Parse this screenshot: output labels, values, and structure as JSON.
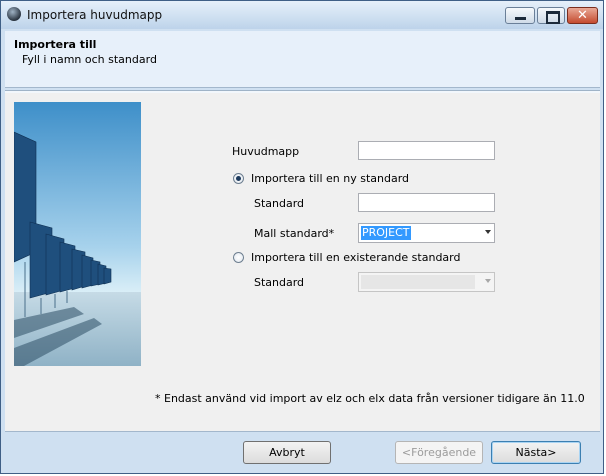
{
  "window": {
    "title": "Importera huvudmapp"
  },
  "header": {
    "title": "Importera till",
    "subtitle": "Fyll i namn och standard"
  },
  "form": {
    "huvudmapp_label": "Huvudmapp",
    "huvudmapp_value": "",
    "radio_new_label": "Importera till en ny standard",
    "radio_new_selected": true,
    "standard_new_label": "Standard",
    "standard_new_value": "",
    "mall_label": "Mall standard*",
    "mall_value": "PROJECT",
    "radio_existing_label": "Importera till en existerande standard",
    "radio_existing_selected": false,
    "standard_existing_label": "Standard",
    "standard_existing_value": ""
  },
  "note": "* Endast använd vid import av elz och elx data från versioner tidigare än 11.0",
  "buttons": {
    "cancel": "Avbryt",
    "previous": "<Föregående",
    "next": "Nästa>"
  },
  "icons": {
    "app": "app-globe-icon",
    "min": "minimize-icon",
    "max": "maximize-icon",
    "close": "close-icon"
  }
}
